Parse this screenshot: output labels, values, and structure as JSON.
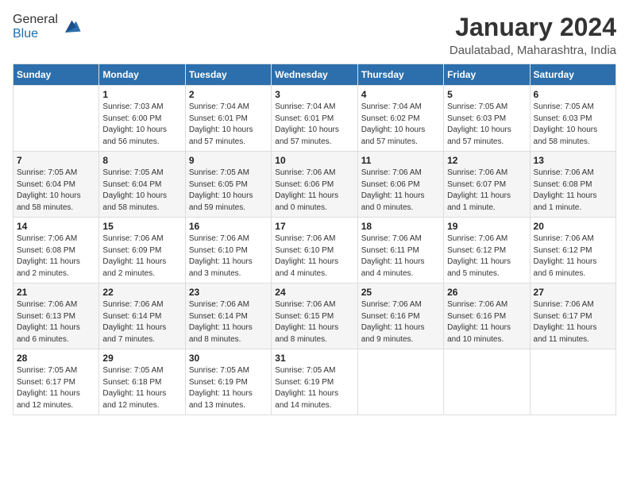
{
  "header": {
    "logo_line1": "General",
    "logo_line2": "Blue",
    "month_title": "January 2024",
    "location": "Daulatabad, Maharashtra, India"
  },
  "weekdays": [
    "Sunday",
    "Monday",
    "Tuesday",
    "Wednesday",
    "Thursday",
    "Friday",
    "Saturday"
  ],
  "weeks": [
    [
      {
        "day": "",
        "info": ""
      },
      {
        "day": "1",
        "info": "Sunrise: 7:03 AM\nSunset: 6:00 PM\nDaylight: 10 hours\nand 56 minutes."
      },
      {
        "day": "2",
        "info": "Sunrise: 7:04 AM\nSunset: 6:01 PM\nDaylight: 10 hours\nand 57 minutes."
      },
      {
        "day": "3",
        "info": "Sunrise: 7:04 AM\nSunset: 6:01 PM\nDaylight: 10 hours\nand 57 minutes."
      },
      {
        "day": "4",
        "info": "Sunrise: 7:04 AM\nSunset: 6:02 PM\nDaylight: 10 hours\nand 57 minutes."
      },
      {
        "day": "5",
        "info": "Sunrise: 7:05 AM\nSunset: 6:03 PM\nDaylight: 10 hours\nand 57 minutes."
      },
      {
        "day": "6",
        "info": "Sunrise: 7:05 AM\nSunset: 6:03 PM\nDaylight: 10 hours\nand 58 minutes."
      }
    ],
    [
      {
        "day": "7",
        "info": "Sunrise: 7:05 AM\nSunset: 6:04 PM\nDaylight: 10 hours\nand 58 minutes."
      },
      {
        "day": "8",
        "info": "Sunrise: 7:05 AM\nSunset: 6:04 PM\nDaylight: 10 hours\nand 58 minutes."
      },
      {
        "day": "9",
        "info": "Sunrise: 7:05 AM\nSunset: 6:05 PM\nDaylight: 10 hours\nand 59 minutes."
      },
      {
        "day": "10",
        "info": "Sunrise: 7:06 AM\nSunset: 6:06 PM\nDaylight: 11 hours\nand 0 minutes."
      },
      {
        "day": "11",
        "info": "Sunrise: 7:06 AM\nSunset: 6:06 PM\nDaylight: 11 hours\nand 0 minutes."
      },
      {
        "day": "12",
        "info": "Sunrise: 7:06 AM\nSunset: 6:07 PM\nDaylight: 11 hours\nand 1 minute."
      },
      {
        "day": "13",
        "info": "Sunrise: 7:06 AM\nSunset: 6:08 PM\nDaylight: 11 hours\nand 1 minute."
      }
    ],
    [
      {
        "day": "14",
        "info": "Sunrise: 7:06 AM\nSunset: 6:08 PM\nDaylight: 11 hours\nand 2 minutes."
      },
      {
        "day": "15",
        "info": "Sunrise: 7:06 AM\nSunset: 6:09 PM\nDaylight: 11 hours\nand 2 minutes."
      },
      {
        "day": "16",
        "info": "Sunrise: 7:06 AM\nSunset: 6:10 PM\nDaylight: 11 hours\nand 3 minutes."
      },
      {
        "day": "17",
        "info": "Sunrise: 7:06 AM\nSunset: 6:10 PM\nDaylight: 11 hours\nand 4 minutes."
      },
      {
        "day": "18",
        "info": "Sunrise: 7:06 AM\nSunset: 6:11 PM\nDaylight: 11 hours\nand 4 minutes."
      },
      {
        "day": "19",
        "info": "Sunrise: 7:06 AM\nSunset: 6:12 PM\nDaylight: 11 hours\nand 5 minutes."
      },
      {
        "day": "20",
        "info": "Sunrise: 7:06 AM\nSunset: 6:12 PM\nDaylight: 11 hours\nand 6 minutes."
      }
    ],
    [
      {
        "day": "21",
        "info": "Sunrise: 7:06 AM\nSunset: 6:13 PM\nDaylight: 11 hours\nand 6 minutes."
      },
      {
        "day": "22",
        "info": "Sunrise: 7:06 AM\nSunset: 6:14 PM\nDaylight: 11 hours\nand 7 minutes."
      },
      {
        "day": "23",
        "info": "Sunrise: 7:06 AM\nSunset: 6:14 PM\nDaylight: 11 hours\nand 8 minutes."
      },
      {
        "day": "24",
        "info": "Sunrise: 7:06 AM\nSunset: 6:15 PM\nDaylight: 11 hours\nand 8 minutes."
      },
      {
        "day": "25",
        "info": "Sunrise: 7:06 AM\nSunset: 6:16 PM\nDaylight: 11 hours\nand 9 minutes."
      },
      {
        "day": "26",
        "info": "Sunrise: 7:06 AM\nSunset: 6:16 PM\nDaylight: 11 hours\nand 10 minutes."
      },
      {
        "day": "27",
        "info": "Sunrise: 7:06 AM\nSunset: 6:17 PM\nDaylight: 11 hours\nand 11 minutes."
      }
    ],
    [
      {
        "day": "28",
        "info": "Sunrise: 7:05 AM\nSunset: 6:17 PM\nDaylight: 11 hours\nand 12 minutes."
      },
      {
        "day": "29",
        "info": "Sunrise: 7:05 AM\nSunset: 6:18 PM\nDaylight: 11 hours\nand 12 minutes."
      },
      {
        "day": "30",
        "info": "Sunrise: 7:05 AM\nSunset: 6:19 PM\nDaylight: 11 hours\nand 13 minutes."
      },
      {
        "day": "31",
        "info": "Sunrise: 7:05 AM\nSunset: 6:19 PM\nDaylight: 11 hours\nand 14 minutes."
      },
      {
        "day": "",
        "info": ""
      },
      {
        "day": "",
        "info": ""
      },
      {
        "day": "",
        "info": ""
      }
    ]
  ]
}
